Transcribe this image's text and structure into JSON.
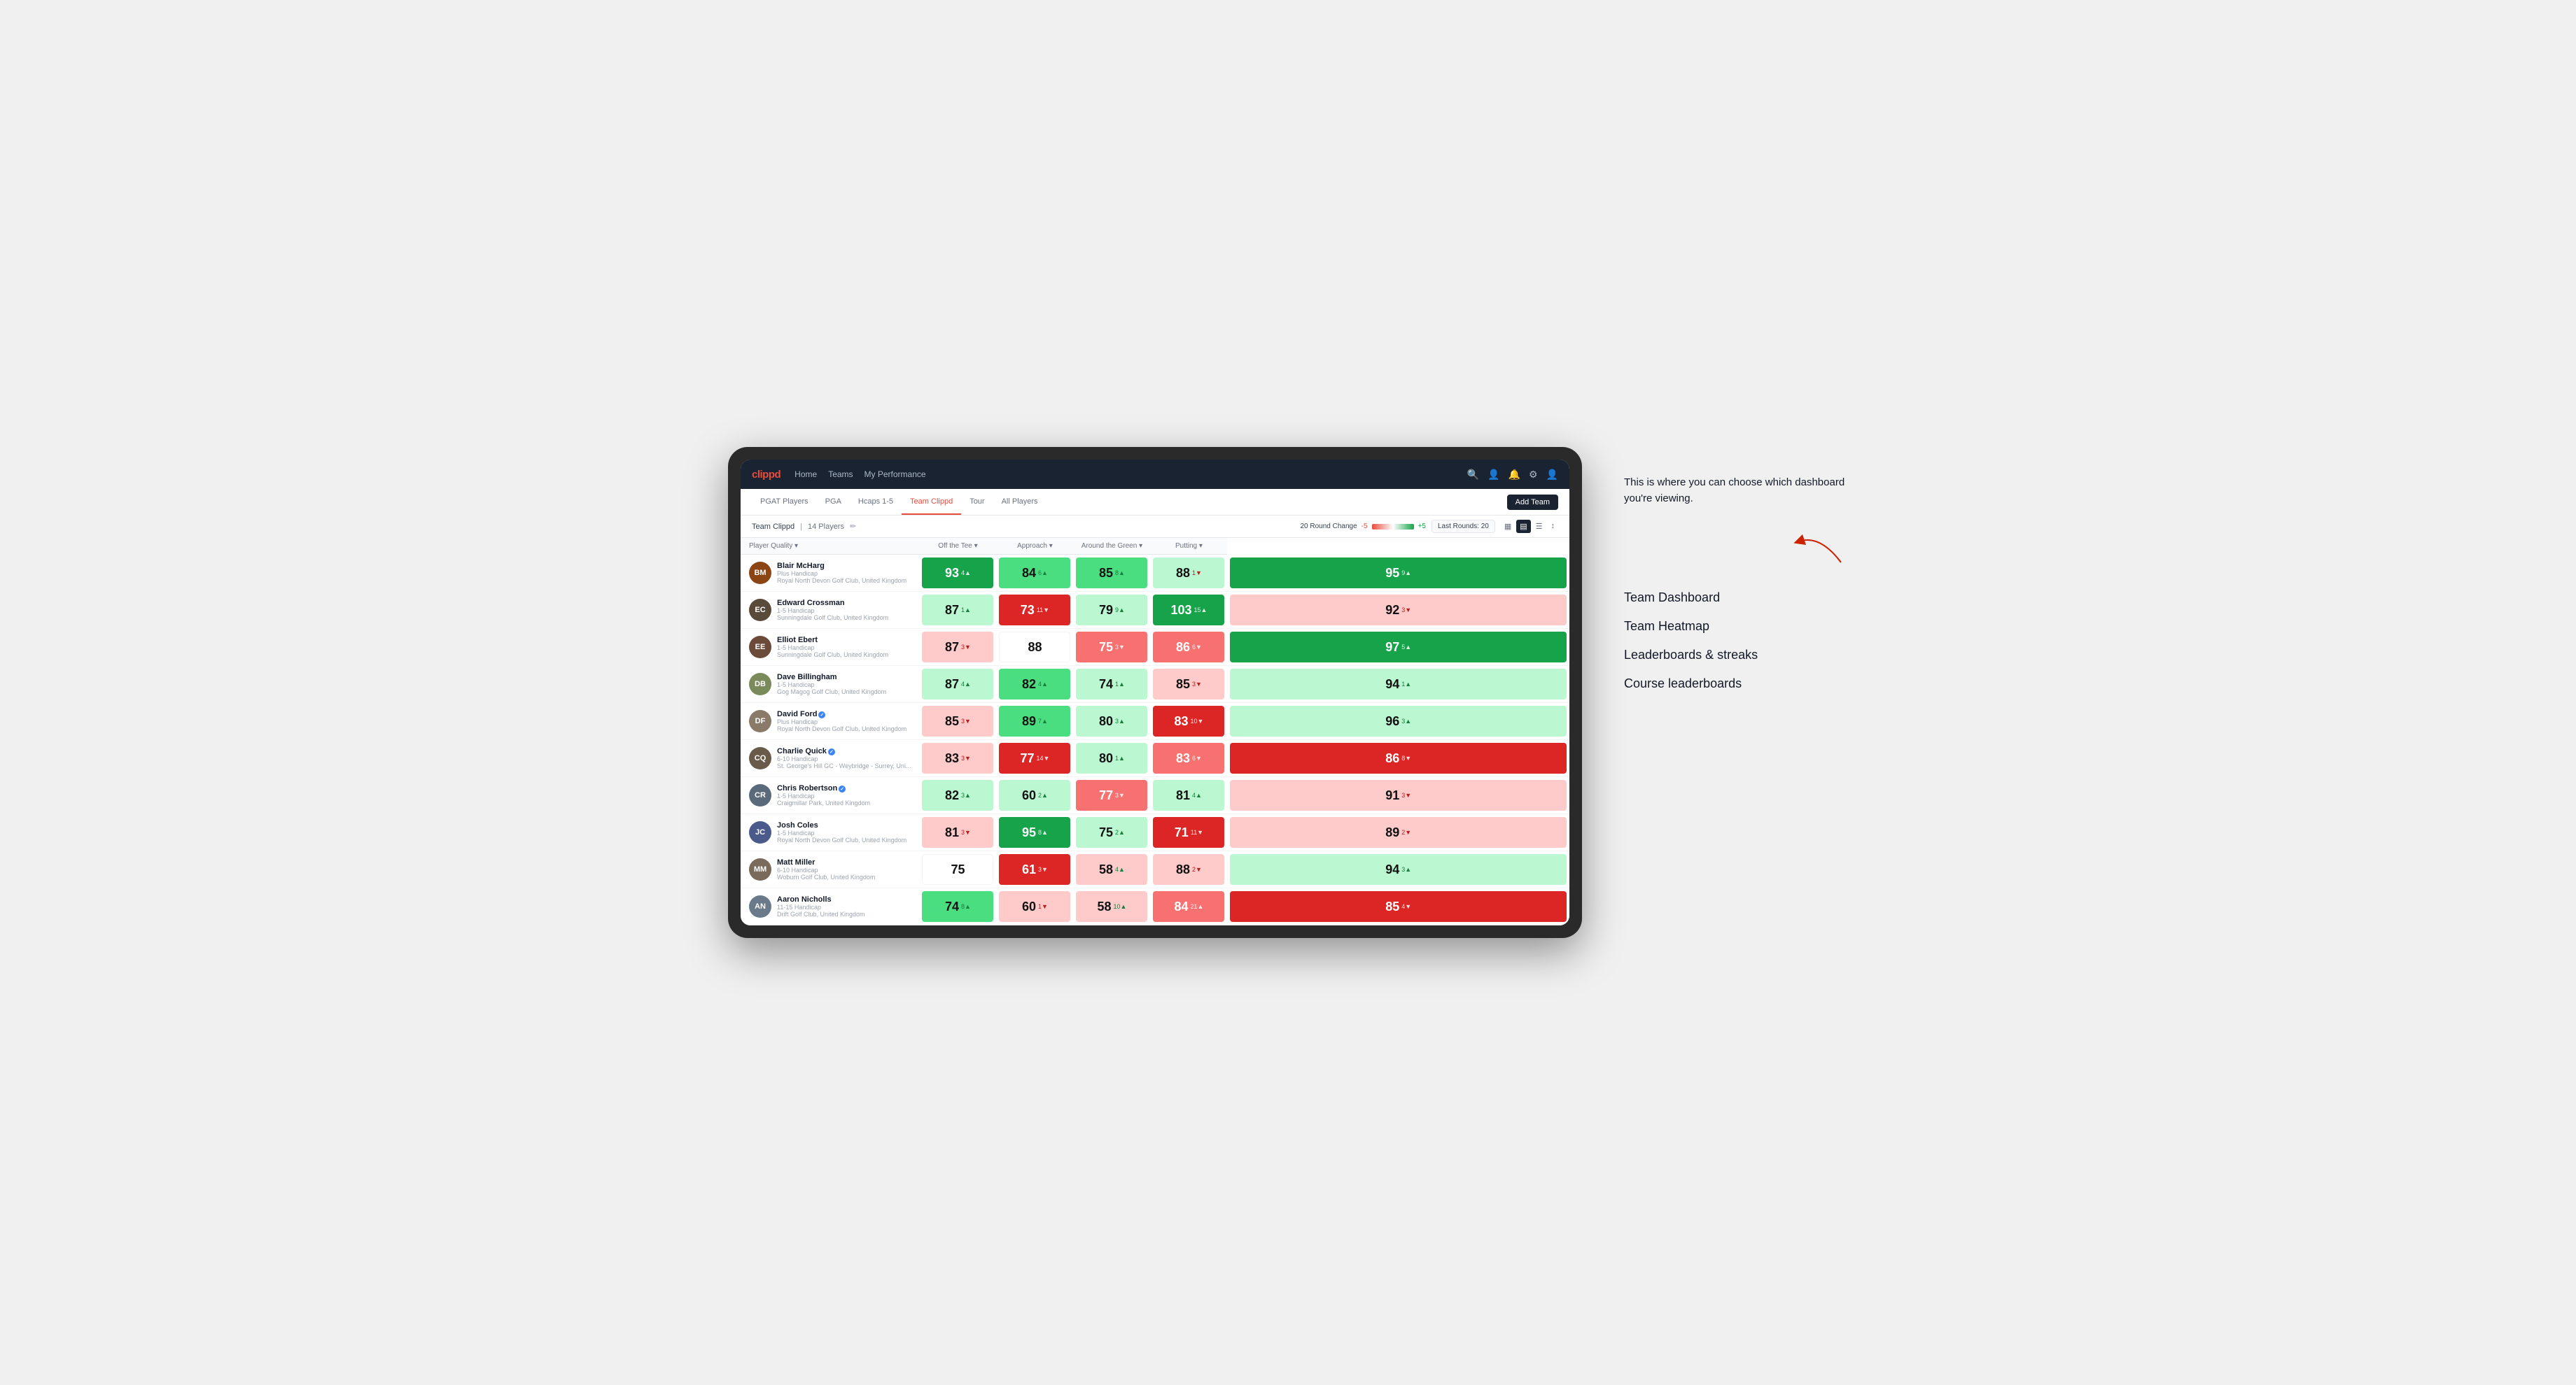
{
  "annotation": {
    "intro": "This is where you can choose which dashboard you're viewing.",
    "items": [
      "Team Dashboard",
      "Team Heatmap",
      "Leaderboards & streaks",
      "Course leaderboards"
    ]
  },
  "navbar": {
    "logo": "clippd",
    "links": [
      "Home",
      "Teams",
      "My Performance"
    ]
  },
  "subnav": {
    "tabs": [
      "PGAT Players",
      "PGA",
      "Hcaps 1-5",
      "Team Clippd",
      "Tour",
      "All Players"
    ],
    "active": "Team Clippd",
    "add_team_label": "Add Team"
  },
  "team_header": {
    "name": "Team Clippd",
    "separator": "|",
    "count": "14 Players",
    "round_change_label": "20 Round Change",
    "change_neg": "-5",
    "change_pos": "+5",
    "last_rounds_label": "Last Rounds: 20"
  },
  "columns": {
    "player": "Player Quality",
    "off_tee": "Off the Tee",
    "approach": "Approach",
    "around_green": "Around the Green",
    "putting": "Putting"
  },
  "players": [
    {
      "name": "Blair McHarg",
      "handicap": "Plus Handicap",
      "club": "Royal North Devon Golf Club, United Kingdom",
      "initials": "BM",
      "scores": [
        {
          "value": "93",
          "change": "4",
          "dir": "up",
          "bg": "bg-green-dark"
        },
        {
          "value": "84",
          "change": "6",
          "dir": "up",
          "bg": "bg-green-med"
        },
        {
          "value": "85",
          "change": "8",
          "dir": "up",
          "bg": "bg-green-med"
        },
        {
          "value": "88",
          "change": "1",
          "dir": "down",
          "bg": "bg-green-light"
        },
        {
          "value": "95",
          "change": "9",
          "dir": "up",
          "bg": "bg-green-dark"
        }
      ]
    },
    {
      "name": "Edward Crossman",
      "handicap": "1-5 Handicap",
      "club": "Sunningdale Golf Club, United Kingdom",
      "initials": "EC",
      "scores": [
        {
          "value": "87",
          "change": "1",
          "dir": "up",
          "bg": "bg-green-light"
        },
        {
          "value": "73",
          "change": "11",
          "dir": "down",
          "bg": "bg-red-dark"
        },
        {
          "value": "79",
          "change": "9",
          "dir": "up",
          "bg": "bg-green-light"
        },
        {
          "value": "103",
          "change": "15",
          "dir": "up",
          "bg": "bg-green-dark"
        },
        {
          "value": "92",
          "change": "3",
          "dir": "down",
          "bg": "bg-red-light"
        }
      ]
    },
    {
      "name": "Elliot Ebert",
      "handicap": "1-5 Handicap",
      "club": "Sunningdale Golf Club, United Kingdom",
      "initials": "EE",
      "scores": [
        {
          "value": "87",
          "change": "3",
          "dir": "down",
          "bg": "bg-red-light"
        },
        {
          "value": "88",
          "change": "",
          "dir": "",
          "bg": "bg-white"
        },
        {
          "value": "75",
          "change": "3",
          "dir": "down",
          "bg": "bg-red-med"
        },
        {
          "value": "86",
          "change": "6",
          "dir": "down",
          "bg": "bg-red-med"
        },
        {
          "value": "97",
          "change": "5",
          "dir": "up",
          "bg": "bg-green-dark"
        }
      ]
    },
    {
      "name": "Dave Billingham",
      "handicap": "1-5 Handicap",
      "club": "Gog Magog Golf Club, United Kingdom",
      "initials": "DB",
      "scores": [
        {
          "value": "87",
          "change": "4",
          "dir": "up",
          "bg": "bg-green-light"
        },
        {
          "value": "82",
          "change": "4",
          "dir": "up",
          "bg": "bg-green-med"
        },
        {
          "value": "74",
          "change": "1",
          "dir": "up",
          "bg": "bg-green-light"
        },
        {
          "value": "85",
          "change": "3",
          "dir": "down",
          "bg": "bg-red-light"
        },
        {
          "value": "94",
          "change": "1",
          "dir": "up",
          "bg": "bg-green-light"
        }
      ]
    },
    {
      "name": "David Ford",
      "handicap": "Plus Handicap",
      "club": "Royal North Devon Golf Club, United Kingdom",
      "initials": "DF",
      "verified": true,
      "scores": [
        {
          "value": "85",
          "change": "3",
          "dir": "down",
          "bg": "bg-red-light"
        },
        {
          "value": "89",
          "change": "7",
          "dir": "up",
          "bg": "bg-green-med"
        },
        {
          "value": "80",
          "change": "3",
          "dir": "up",
          "bg": "bg-green-light"
        },
        {
          "value": "83",
          "change": "10",
          "dir": "down",
          "bg": "bg-red-dark"
        },
        {
          "value": "96",
          "change": "3",
          "dir": "up",
          "bg": "bg-green-light"
        }
      ]
    },
    {
      "name": "Charlie Quick",
      "handicap": "6-10 Handicap",
      "club": "St. George's Hill GC - Weybridge - Surrey, Uni...",
      "initials": "CQ",
      "verified": true,
      "scores": [
        {
          "value": "83",
          "change": "3",
          "dir": "down",
          "bg": "bg-red-light"
        },
        {
          "value": "77",
          "change": "14",
          "dir": "down",
          "bg": "bg-red-dark"
        },
        {
          "value": "80",
          "change": "1",
          "dir": "up",
          "bg": "bg-green-light"
        },
        {
          "value": "83",
          "change": "6",
          "dir": "down",
          "bg": "bg-red-med"
        },
        {
          "value": "86",
          "change": "8",
          "dir": "down",
          "bg": "bg-red-dark"
        }
      ]
    },
    {
      "name": "Chris Robertson",
      "handicap": "1-5 Handicap",
      "club": "Craigmillar Park, United Kingdom",
      "initials": "CR",
      "verified": true,
      "scores": [
        {
          "value": "82",
          "change": "3",
          "dir": "up",
          "bg": "bg-green-light"
        },
        {
          "value": "60",
          "change": "2",
          "dir": "up",
          "bg": "bg-green-light"
        },
        {
          "value": "77",
          "change": "3",
          "dir": "down",
          "bg": "bg-red-med"
        },
        {
          "value": "81",
          "change": "4",
          "dir": "up",
          "bg": "bg-green-light"
        },
        {
          "value": "91",
          "change": "3",
          "dir": "down",
          "bg": "bg-red-light"
        }
      ]
    },
    {
      "name": "Josh Coles",
      "handicap": "1-5 Handicap",
      "club": "Royal North Devon Golf Club, United Kingdom",
      "initials": "JC",
      "scores": [
        {
          "value": "81",
          "change": "3",
          "dir": "down",
          "bg": "bg-red-light"
        },
        {
          "value": "95",
          "change": "8",
          "dir": "up",
          "bg": "bg-green-dark"
        },
        {
          "value": "75",
          "change": "2",
          "dir": "up",
          "bg": "bg-green-light"
        },
        {
          "value": "71",
          "change": "11",
          "dir": "down",
          "bg": "bg-red-dark"
        },
        {
          "value": "89",
          "change": "2",
          "dir": "down",
          "bg": "bg-red-light"
        }
      ]
    },
    {
      "name": "Matt Miller",
      "handicap": "6-10 Handicap",
      "club": "Woburn Golf Club, United Kingdom",
      "initials": "MM",
      "scores": [
        {
          "value": "75",
          "change": "",
          "dir": "",
          "bg": "bg-white"
        },
        {
          "value": "61",
          "change": "3",
          "dir": "down",
          "bg": "bg-red-dark"
        },
        {
          "value": "58",
          "change": "4",
          "dir": "up",
          "bg": "bg-red-light"
        },
        {
          "value": "88",
          "change": "2",
          "dir": "down",
          "bg": "bg-red-light"
        },
        {
          "value": "94",
          "change": "3",
          "dir": "up",
          "bg": "bg-green-light"
        }
      ]
    },
    {
      "name": "Aaron Nicholls",
      "handicap": "11-15 Handicap",
      "club": "Drift Golf Club, United Kingdom",
      "initials": "AN",
      "scores": [
        {
          "value": "74",
          "change": "8",
          "dir": "up",
          "bg": "bg-green-med"
        },
        {
          "value": "60",
          "change": "1",
          "dir": "down",
          "bg": "bg-red-light"
        },
        {
          "value": "58",
          "change": "10",
          "dir": "up",
          "bg": "bg-red-light"
        },
        {
          "value": "84",
          "change": "21",
          "dir": "up",
          "bg": "bg-red-med"
        },
        {
          "value": "85",
          "change": "4",
          "dir": "down",
          "bg": "bg-red-dark"
        }
      ]
    }
  ]
}
